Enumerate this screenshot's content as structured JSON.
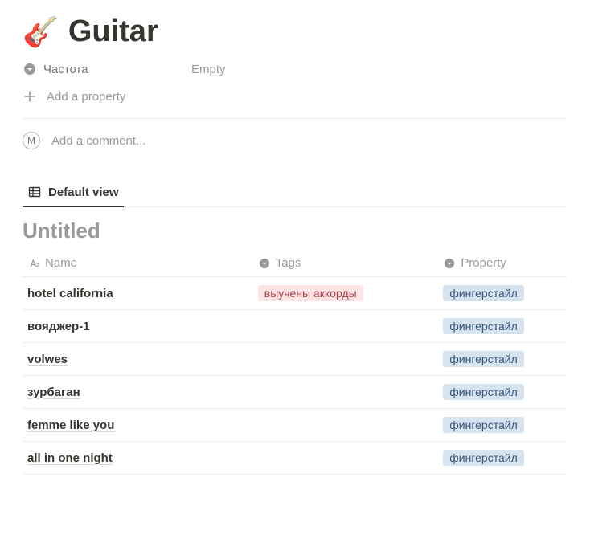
{
  "page": {
    "icon": "🎸",
    "title": "Guitar"
  },
  "properties": [
    {
      "icon": "select",
      "label": "Частота",
      "value": "Empty"
    }
  ],
  "add_property_label": "Add a property",
  "comment": {
    "avatar_initial": "M",
    "placeholder": "Add a comment..."
  },
  "view": {
    "active_label": "Default view"
  },
  "table": {
    "title": "Untitled",
    "columns": [
      {
        "key": "name",
        "label": "Name",
        "icon": "title"
      },
      {
        "key": "tags",
        "label": "Tags",
        "icon": "select"
      },
      {
        "key": "property",
        "label": "Property",
        "icon": "select"
      }
    ],
    "rows": [
      {
        "name": "hotel california",
        "tags": [
          {
            "text": "выучены аккорды",
            "color": "red"
          }
        ],
        "property": [
          {
            "text": "фингерстайл",
            "color": "blue"
          }
        ]
      },
      {
        "name": "вояджер-1",
        "tags": [],
        "property": [
          {
            "text": "фингерстайл",
            "color": "blue"
          }
        ]
      },
      {
        "name": "volwes",
        "tags": [],
        "property": [
          {
            "text": "фингерстайл",
            "color": "blue"
          }
        ]
      },
      {
        "name": "зурбаган",
        "tags": [],
        "property": [
          {
            "text": "фингерстайл",
            "color": "blue"
          }
        ]
      },
      {
        "name": "femme like you",
        "tags": [],
        "property": [
          {
            "text": "фингерстайл",
            "color": "blue"
          }
        ]
      },
      {
        "name": "all in one night",
        "tags": [],
        "property": [
          {
            "text": "фингерстайл",
            "color": "blue"
          }
        ]
      }
    ]
  }
}
